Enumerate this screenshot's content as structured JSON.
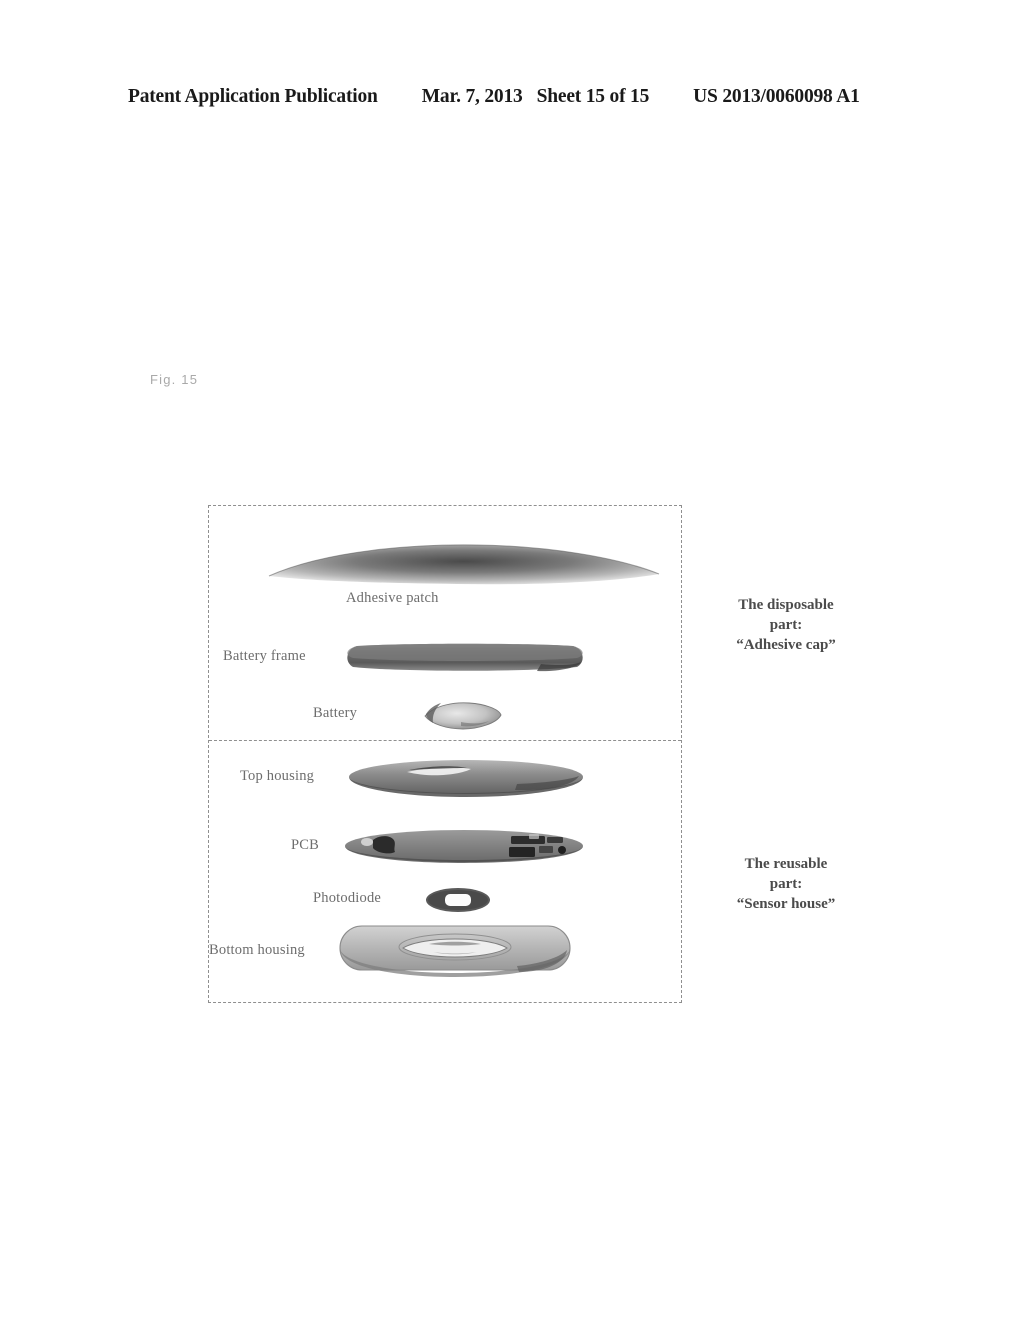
{
  "header": {
    "publication": "Patent Application Publication",
    "date": "Mar. 7, 2013",
    "sheet": "Sheet 15 of 15",
    "patent_number": "US 2013/0060098 A1"
  },
  "figure": {
    "label": "Fig. 15",
    "parts": [
      {
        "id": "adhesive-patch",
        "label": "Adhesive patch",
        "section": "disposable"
      },
      {
        "id": "battery-frame",
        "label": "Battery frame",
        "section": "disposable"
      },
      {
        "id": "battery",
        "label": "Battery",
        "section": "disposable"
      },
      {
        "id": "top-housing",
        "label": "Top housing",
        "section": "reusable"
      },
      {
        "id": "pcb",
        "label": "PCB",
        "section": "reusable"
      },
      {
        "id": "photodiode",
        "label": "Photodiode",
        "section": "reusable"
      },
      {
        "id": "bottom-housing",
        "label": "Bottom housing",
        "section": "reusable"
      }
    ],
    "captions": {
      "disposable": {
        "line1": "The disposable",
        "line2": "part:",
        "line3": "“Adhesive cap”"
      },
      "reusable": {
        "line1": "The reusable",
        "line2": "part:",
        "line3": "“Sensor house”"
      }
    }
  },
  "colors": {
    "ink": "#1a1a1a",
    "label_gray": "#6d6d6d",
    "fig_gray": "#a9a9a9",
    "dash_gray": "#8f8f8f",
    "caption_gray": "#4b4b4b"
  }
}
